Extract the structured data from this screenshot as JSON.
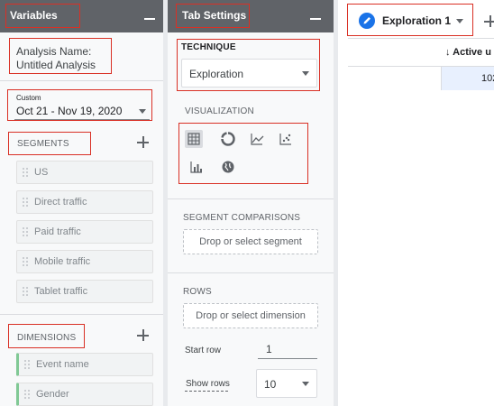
{
  "variables": {
    "title": "Variables",
    "analysis_name_label": "Analysis Name:",
    "analysis_name_value": "Untitled Analysis",
    "date_range_small": "Custom",
    "date_range_value": "Oct 21 - Nov 19, 2020",
    "segments_label": "SEGMENTS",
    "segments": [
      {
        "label": "US"
      },
      {
        "label": "Direct traffic"
      },
      {
        "label": "Paid traffic"
      },
      {
        "label": "Mobile traffic"
      },
      {
        "label": "Tablet traffic"
      }
    ],
    "dimensions_label": "DIMENSIONS",
    "dimensions": [
      {
        "label": "Event name"
      },
      {
        "label": "Gender"
      }
    ]
  },
  "tab_settings": {
    "title": "Tab Settings",
    "technique_label": "TECHNIQUE",
    "technique_value": "Exploration",
    "visualization_label": "VISUALIZATION",
    "visualizations": [
      {
        "icon": "table-icon",
        "selected": true
      },
      {
        "icon": "donut-chart-icon"
      },
      {
        "icon": "line-chart-icon"
      },
      {
        "icon": "scatter-plot-icon"
      },
      {
        "icon": "bar-chart-icon"
      },
      {
        "icon": "geo-map-icon"
      }
    ],
    "segment_comparisons_label": "SEGMENT COMPARISONS",
    "segment_drop_placeholder": "Drop or select segment",
    "rows_label": "ROWS",
    "rows_drop_placeholder": "Drop or select dimension",
    "start_row_label": "Start row",
    "start_row_value": "1",
    "show_rows_label": "Show rows",
    "show_rows_value": "10"
  },
  "main": {
    "tab_label": "Exploration 1",
    "column_header": "↓ Active u",
    "cell_value": "102"
  },
  "colors": {
    "header_bg": "#606368",
    "annotation_red": "#d93025",
    "accent_blue": "#1a73e8",
    "dimension_green": "#81c995"
  }
}
